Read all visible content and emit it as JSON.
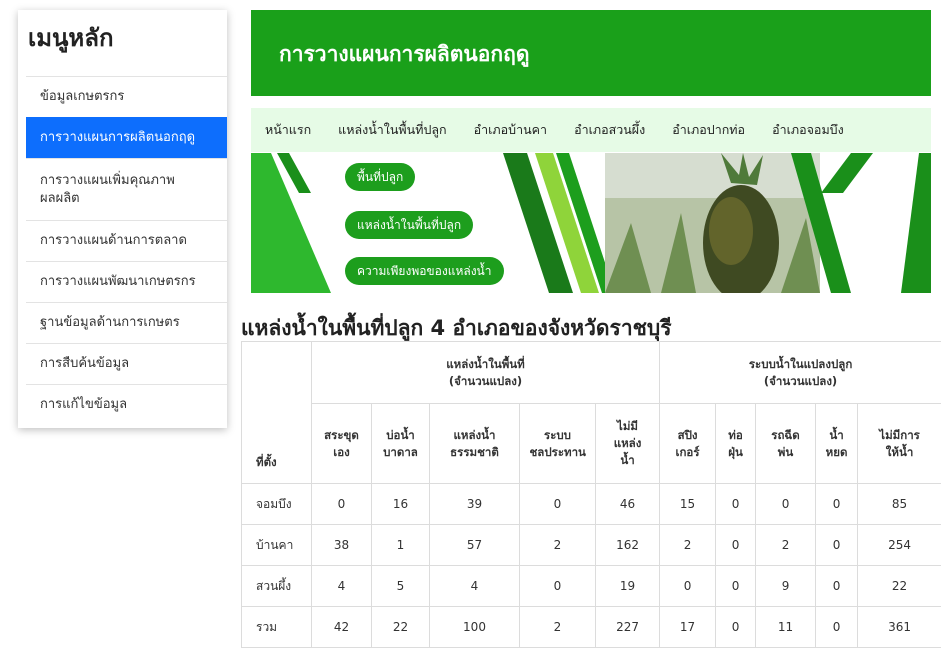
{
  "sidebar": {
    "title": "เมนูหลัก",
    "items": [
      {
        "label": "ข้อมูลเกษตรกร"
      },
      {
        "label": "การวางแผนการผลิตนอกฤดู"
      },
      {
        "label": "การวางแผนเพิ่มคุณภาพ ผลผลิต"
      },
      {
        "label": "การวางแผนด้านการตลาด"
      },
      {
        "label": "การวางแผนพัฒนาเกษตรกร"
      },
      {
        "label": "ฐานข้อมูลด้านการเกษตร"
      },
      {
        "label": "การสืบค้นข้อมูล"
      },
      {
        "label": "การแก้ไขข้อมูล"
      }
    ]
  },
  "header": {
    "title": "การวางแผนการผลิตนอกฤดู"
  },
  "nav": {
    "items": [
      "หน้าแรก",
      "แหล่งน้ำในพื้นที่ปลูก",
      "อำเภอบ้านคา",
      "อำเภอสวนผึ้ง",
      "อำเภอปากท่อ",
      "อำเภอจอมบึง"
    ]
  },
  "banner": {
    "buttons": [
      "พื้นที่ปลูก",
      "แหล่งน้ำในพื้นที่ปลูก",
      "ความเพียงพอของแหล่งน้ำ"
    ]
  },
  "section": {
    "title": "แหล่งน้ำในพื้นที่ปลูก 4 อำเภอของจังหวัดราชบุรี"
  },
  "table": {
    "group1_line1": "แหล่งน้ำในพื้นที่",
    "group1_line2": "(จำนวนแปลง)",
    "group2_line1": "ระบบน้ำในแปลงปลูก",
    "group2_line2": "(จำนวนแปลง)",
    "columns": [
      {
        "label": "ที่ตั้ง"
      },
      {
        "label": "สระขุด เอง"
      },
      {
        "label": "บ่อน้ำ บาดาล"
      },
      {
        "label": "แหล่งน้ำ ธรรมชาติ"
      },
      {
        "label": "ระบบ ชลประทาน"
      },
      {
        "label": "ไม่มี แหล่ง น้ำ"
      },
      {
        "label": "สปิง เกอร์"
      },
      {
        "label": "ท่อ ฝุ่น"
      },
      {
        "label": "รถฉีด พ่น"
      },
      {
        "label": "น้ำ หยด"
      },
      {
        "label": "ไม่มีการ ให้น้ำ"
      }
    ],
    "rows": [
      [
        "จอมบึง",
        "0",
        "16",
        "39",
        "0",
        "46",
        "15",
        "0",
        "0",
        "0",
        "85"
      ],
      [
        "บ้านคา",
        "38",
        "1",
        "57",
        "2",
        "162",
        "2",
        "0",
        "2",
        "0",
        "254"
      ],
      [
        "สวนผึ้ง",
        "4",
        "5",
        "4",
        "0",
        "19",
        "0",
        "0",
        "9",
        "0",
        "22"
      ],
      [
        "รวม",
        "42",
        "22",
        "100",
        "2",
        "227",
        "17",
        "0",
        "11",
        "0",
        "361"
      ]
    ]
  }
}
